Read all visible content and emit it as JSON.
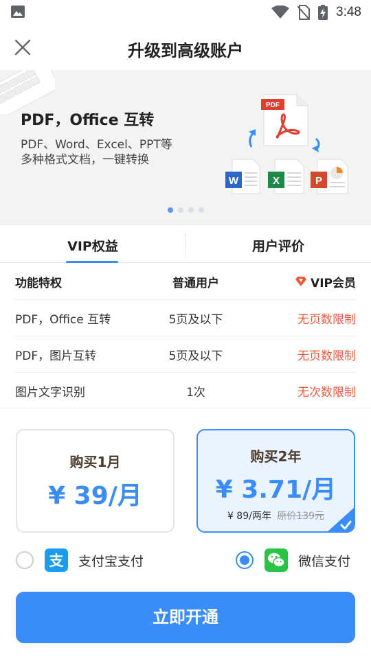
{
  "status_bar": {
    "time": "3:48",
    "icons": [
      "image-icon",
      "wifi-icon",
      "no-sim-icon",
      "battery-charging-icon"
    ]
  },
  "header": {
    "title": "升级到高级账户",
    "close_icon": "close-icon"
  },
  "banner": {
    "title": "PDF，Office 互转",
    "subtitle_line1": "PDF、Word、Excel、PPT等",
    "subtitle_line2": "多种格式文档，一键转换",
    "file_badges": {
      "pdf": "PDF",
      "word": "W",
      "excel": "X",
      "ppt": "P"
    },
    "carousel_dots": 4,
    "active_dot": 0
  },
  "tabs": [
    {
      "label": "VIP权益",
      "active": true
    },
    {
      "label": "用户评价",
      "active": false
    }
  ],
  "compare": {
    "headers": {
      "feature": "功能特权",
      "normal": "普通用户",
      "vip": "VIP会员"
    },
    "rows": [
      {
        "feature": "PDF，Office 互转",
        "normal": "5页及以下",
        "vip": "无页数限制"
      },
      {
        "feature": "PDF，图片互转",
        "normal": "5页及以下",
        "vip": "无页数限制"
      },
      {
        "feature": "图片文字识别",
        "normal": "1次",
        "vip": "无次数限制"
      }
    ]
  },
  "plans": [
    {
      "label": "购买1月",
      "price": "¥ 39/月",
      "selected": false
    },
    {
      "label": "购买2年",
      "price": "¥ 3.71/月",
      "note": "¥ 89/两年",
      "original": "原价139元",
      "selected": true
    }
  ],
  "payment": [
    {
      "label": "支付宝支付",
      "icon": "alipay-icon",
      "icon_char": "支",
      "selected": false
    },
    {
      "label": "微信支付",
      "icon": "wechat-icon",
      "selected": true
    }
  ],
  "cta": {
    "label": "立即开通"
  },
  "colors": {
    "accent": "#3a8cf6",
    "vip_red": "#ef5a3c",
    "plan_selected_bg": "#eaf3ff",
    "alipay": "#1a9cf0",
    "wechat": "#28c445"
  }
}
